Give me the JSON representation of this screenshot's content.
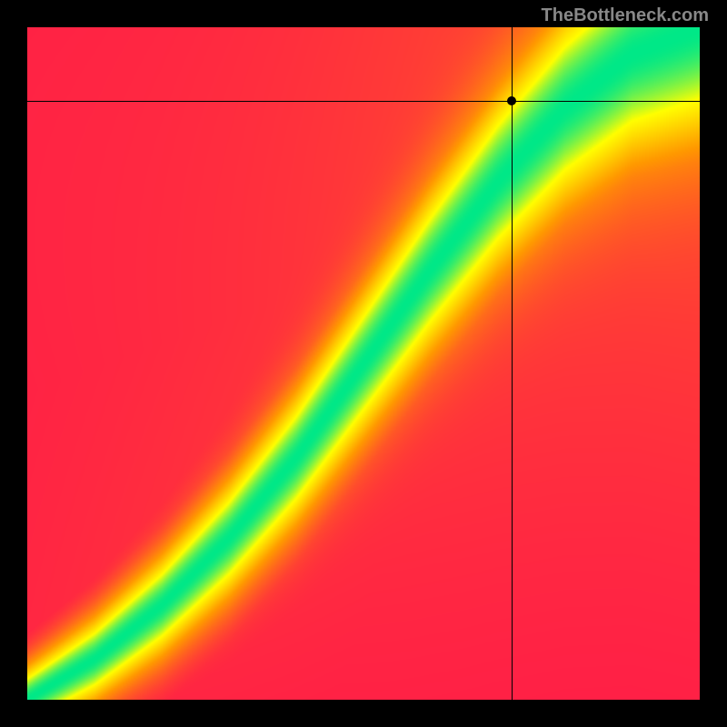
{
  "watermark": "TheBottleneck.com",
  "chart_data": {
    "type": "heatmap",
    "title": "",
    "xlabel": "",
    "ylabel": "",
    "xlim": [
      0,
      1
    ],
    "ylim": [
      0,
      1
    ],
    "grid": false,
    "legend_position": "none",
    "colorscale": {
      "low": "#ff1a4a",
      "mid_low": "#ff9a00",
      "mid": "#ffff00",
      "high": "#00e888"
    },
    "ridge_curve_x_vs_y": [
      [
        0.0,
        0.0
      ],
      [
        0.1,
        0.06
      ],
      [
        0.2,
        0.14
      ],
      [
        0.3,
        0.24
      ],
      [
        0.4,
        0.36
      ],
      [
        0.5,
        0.5
      ],
      [
        0.6,
        0.64
      ],
      [
        0.7,
        0.77
      ],
      [
        0.8,
        0.88
      ],
      [
        0.9,
        0.96
      ],
      [
        1.0,
        1.0
      ]
    ],
    "ridge_note": "green ridge runs diagonally bottom-left to top-right with slight S-curve; value peaks (green) on the ridge, falls through yellow/orange to red away from it",
    "crosshair": {
      "x_fraction": 0.72,
      "y_fraction": 0.89
    },
    "marker": {
      "x_fraction": 0.72,
      "y_fraction": 0.89
    }
  },
  "colors": {
    "background": "#000000",
    "watermark": "#888888",
    "crosshair": "#000000"
  }
}
